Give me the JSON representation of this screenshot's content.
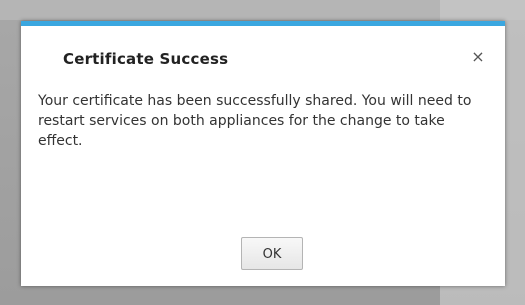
{
  "dialog": {
    "title": "Certificate Success",
    "close_glyph": "×",
    "close_icon": "close-icon",
    "message": "Your certificate has been successfully shared.  You will need to restart services on both appliances for the change to take effect.",
    "ok_label": "OK",
    "accent_color": "#3aa7e0"
  }
}
